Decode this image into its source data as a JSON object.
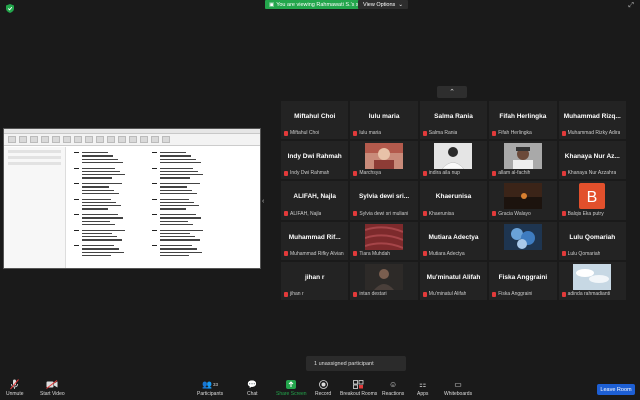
{
  "top": {
    "viewing_text": "You are viewing Rahmawati S.'s screen",
    "view_options": "View Options"
  },
  "gallery": {
    "tiles": [
      {
        "big": "Miftahul Choi",
        "small": "Miftahul Choi",
        "photo": ""
      },
      {
        "big": "lulu maria",
        "small": "lulu maria",
        "photo": ""
      },
      {
        "big": "Salma Rania",
        "small": "Salma Rania",
        "photo": ""
      },
      {
        "big": "Fifah Herlingka",
        "small": "Fifah Herlingka",
        "photo": ""
      },
      {
        "big": "Muhammad Rizq...",
        "small": "Muhammad Rizky Adira",
        "photo": ""
      },
      {
        "big": "Indy Dwi Rahmah",
        "small": "Indy Dwi Rahmah",
        "photo": ""
      },
      {
        "big": "",
        "small": "Marchsya",
        "photo": "girl-red"
      },
      {
        "big": "",
        "small": "indira aila nup",
        "photo": "white-shirt"
      },
      {
        "big": "",
        "small": "allam al-fachih",
        "photo": "man-cap"
      },
      {
        "big": "Khanaya Nur Az...",
        "small": "Khanaya Nur Azzahra",
        "photo": ""
      },
      {
        "big": "ALIFAH, Najla",
        "small": "ALIFAH, Najla",
        "photo": ""
      },
      {
        "big": "Sylvia dewi sri...",
        "small": "Sylvia dewi sri muliani",
        "photo": ""
      },
      {
        "big": "Khaerunisa",
        "small": "Khaerunisa",
        "photo": ""
      },
      {
        "big": "",
        "small": "Gracia Walayo",
        "photo": "sunset"
      },
      {
        "big": "",
        "small": "Balqis Eka putry",
        "photo": "letter-b"
      },
      {
        "big": "Muhammad Rif...",
        "small": "Muhammad Rifky Alvian",
        "photo": ""
      },
      {
        "big": "",
        "small": "Tiara Muhdah",
        "photo": "fabric"
      },
      {
        "big": "Mutiara Adectya",
        "small": "Mutiara Adectya",
        "photo": ""
      },
      {
        "big": "",
        "small": "",
        "photo": "balloons"
      },
      {
        "big": "Lulu Qomariah",
        "small": "Lulu Qomariah",
        "photo": ""
      },
      {
        "big": "jihan r",
        "small": "jihan r",
        "photo": ""
      },
      {
        "big": "",
        "small": "intan destari",
        "photo": "person-dark"
      },
      {
        "big": "Mu'minatul Alifah",
        "small": "Mu'minatul Alifah",
        "photo": ""
      },
      {
        "big": "Fiska Anggraini",
        "small": "Fiska Anggraini",
        "photo": ""
      },
      {
        "big": "",
        "small": "adinda rahmadianti",
        "photo": "clouds"
      }
    ]
  },
  "unassigned": "1 unassigned participant",
  "toolbar": {
    "unmute": "Unmute",
    "start_video": "Start Video",
    "participants": "Participants",
    "participants_count": "33",
    "chat": "Chat",
    "share_screen": "Share Screen",
    "record": "Record",
    "breakout_rooms": "Breakout Rooms",
    "reactions": "Reactions",
    "apps": "Apps",
    "whiteboards": "Whiteboards",
    "leave": "Leave Room"
  },
  "colors": {
    "accent_green": "#23a64c",
    "leave_blue": "#1d5fd4",
    "muted_red": "#e23a3a",
    "tile_bg": "#232323"
  }
}
